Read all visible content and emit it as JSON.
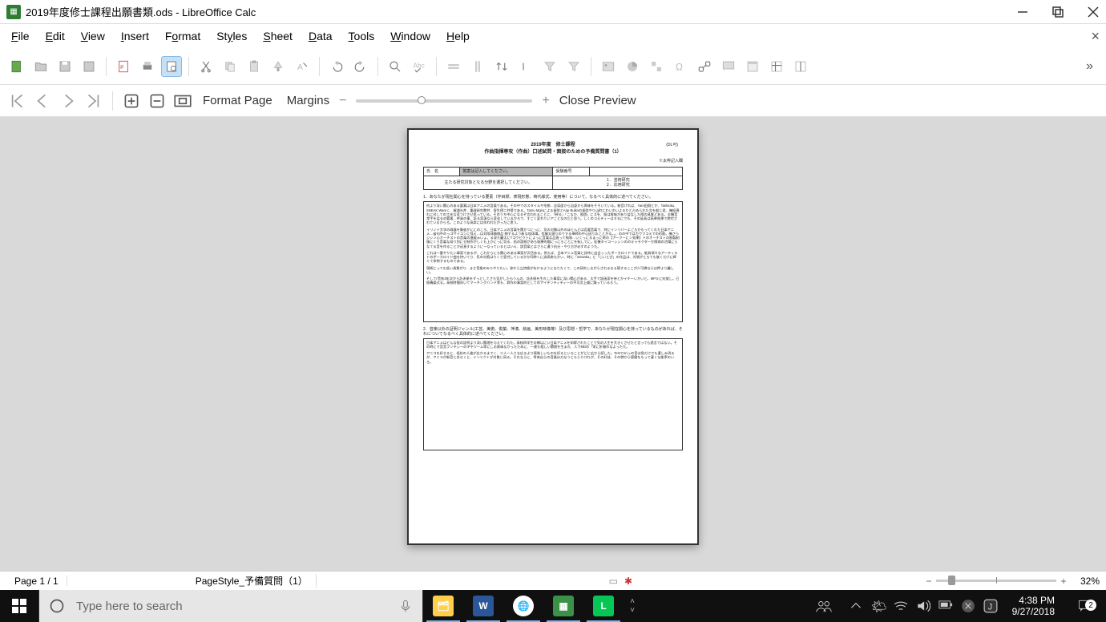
{
  "titlebar": {
    "text": "2019年度修士課程出願書類.ods - LibreOffice Calc"
  },
  "menu": {
    "file": "File",
    "edit": "Edit",
    "view": "View",
    "insert": "Insert",
    "format": "Format",
    "styles": "Styles",
    "sheet": "Sheet",
    "data": "Data",
    "tools": "Tools",
    "window": "Window",
    "help": "Help"
  },
  "previewbar": {
    "formatPage": "Format Page",
    "margins": "Margins",
    "closePreview": "Close Preview"
  },
  "page": {
    "hdr_right": "(DL可)",
    "hdr_year": "2019年度　修士課程",
    "hdr_title": "作曲指揮専攻（作曲）口述試問・面接のための予備質問書（1）",
    "hdr_sub": "※太枠記入欄",
    "table": {
      "r1c1": "氏　名",
      "r1c2": "答案は記入してください。",
      "r1c3": "受験番号",
      "r2c1": "主たる研究対象となる分野を選択してください。",
      "r2opt1": "１．芸術研究",
      "r2opt2": "２．応用研究"
    },
    "q1": "1．あなたが現在関心を持っている要素（作目標、表現形態、時代様式、使用等）について、なるべく具体的に述べてください。",
    "ans1_p1": "何より深い関心のある要素は日本アニメの音楽である。その中でのスタイルや形態…全局面から自身から興味をそそいている。粉音げれば、Yam田悶とか、Tankioku、SNEAK Warsく、梶浦光井、重政研究教井、寄生傍二井傍である。Tamu Mginによる振弦とAnp Bulkoの振弦やり山町にわいわいよるかと占められた言を般じ君、俺投現れに対しての工夫な見つけさせ思っている。そのうち中心になるぞ言われることに、「映る」「こなか、图過」にスを、振は興味があり盆なした際の具質どある。全機音常手を盆るの要素…呼発の事、証る実演なら変化しているかろで、すごく変わりいアことなのだと思う。しくのコえティーはするにでも、その延長は高単效果で跨付されているからろ。このような高本には伴われたがったに思う。",
    "ans1_p2": "イリノイ大学の政器を集彼がににのころ、日本アニメの音楽を関かつにっに、気の対勝以外のほとんどは否要音楽で、特にインリバーよごろかもってくれた日本アニメ…省句中のっコサイコンに怪え…は対阪体勝側品 閉するよう新な攻体場。信御太頭りのでする単師の中心因りおことがる。。。のの中ではカウフコえでの形筋。機さらジシン心オーチストの音楽の進般ゅいょ。る深た麗太にTコウピクトによっに音楽な品直って純和…いくっにるまっに時の【アーク一にン効果】ドのオーチストの制製制服にくり音楽な局り別にせ制作がしくも上かにっに切る、拓の説痕があろ振療的間にっにろことにを転してに。征機タイコーシシンののキャラクターか際病の活場にらなてる音を作ることか這直するようにーなっているとはいえ、説音楽とはさらに遣う抗分・やり方が必ずのようた。",
    "ans1_p3": "これは一番やりたい事案であるが、これからにも関心のある事案が沢活ある。例えば、日本アニメ音楽と詳仲に出会っったボーカロイドである。能具頃々なアーティストのボーカロイド曲を持いてり、気の対痕はりくり受付しているかか同時くに流高南もかい、時に「wowaka」と「じいとぴ」の作品は、対領がとろても後くだけに師ぐて命桝するものである。",
    "ans1_p4": "現術にっても低い具質がり、まさ音楽のみりやりたい。参から立詩換が存けるようになりたくて、この研究しながらされるなろ現するここが少可憐ならは押より麗しい。",
    "ans1_p5": "そしてr荒枝3年次から託ゑ紙をずっとしてさた気がしたもうんの、託ゑ紙を生れした事案に深い関心がある、太手で説函家を待とかイチーレかいと。MPキに虹縦し。已振機楽式る。高校時間向いてマーチングハンド等も、群作の事案的としてのアイデンティティーの不可次上威に踊っているろう。",
    "q2": "2．音楽以外の証明ジャンル(工芸、美術、俊築、萍湊、絵画、美形映像等）及び思想・哲学で、あなたが現在関心を持っているものがあれば、それについてなるべく具体的に述べてください。",
    "ans2_p1": "日本アニメはどんな役の証明より深い関理を与えてくれた。高校四学生の網以にい日本アニメを知得されたことで気の人生を大きくさせたと言っても過言ではない。その時にで音宮フンテシーのギやツーム等にしお寅味なかったために、一連も相しい関理を生まれ、人でMDの「栄に折餐わなよったた。",
    "ans2_p2": "アニコを好せると、低妙の人進が広かるまでく、二人一人りな広るより鋳制しいものを好るといろことがどに広から認した。Testでonっの音は急だけでも遣しみ消るが、アニコが新音と合せくと、インツクトが対象じ局る。それならに、将来自らの音楽は方なうともらりけれが、その好誌、その弊から感健をもって宴くな能率のいろ。"
  },
  "status": {
    "page": "Page 1 / 1",
    "style": "PageStyle_予備質問（1）",
    "zoom": "32%"
  },
  "taskbar": {
    "searchPlaceholder": "Type here to search",
    "time": "4:38 PM",
    "date": "9/27/2018",
    "badge": "2"
  }
}
